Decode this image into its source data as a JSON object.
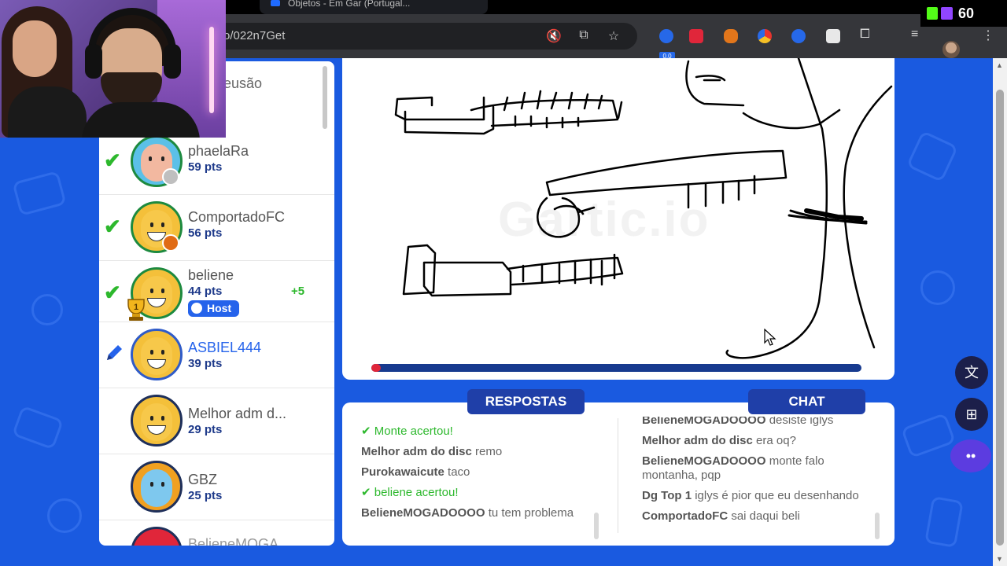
{
  "browser": {
    "tab_title": "Objetos - Em Gar (Portugal...",
    "url": "o/022n7Get",
    "extension_badge": "0.0",
    "viewer_count": "60"
  },
  "players": [
    {
      "name": "eusão",
      "pts": "",
      "state": "partial",
      "gain": "",
      "host": false
    },
    {
      "name": "phaelaRa",
      "pts": "59 pts",
      "state": "guessed",
      "gain": "",
      "host": false,
      "badge_color": "#bfbfbf"
    },
    {
      "name": "ComportadoFC",
      "pts": "56 pts",
      "state": "guessed",
      "gain": "",
      "host": false,
      "badge_color": "#e06b15"
    },
    {
      "name": "beliene",
      "pts": "44 pts",
      "state": "guessed",
      "gain": "+5",
      "host": true,
      "rank": "1"
    },
    {
      "name": "ASBIEL444",
      "pts": "39 pts",
      "state": "drawing",
      "gain": "",
      "host": false
    },
    {
      "name": "Melhor adm d...",
      "pts": "29 pts",
      "state": "none",
      "gain": "",
      "host": false
    },
    {
      "name": "GBZ",
      "pts": "25 pts",
      "state": "none",
      "gain": "",
      "host": false
    },
    {
      "name": "BelieneMOGA...",
      "pts": "",
      "state": "partial",
      "gain": "",
      "host": false
    }
  ],
  "host_label": "Host",
  "canvas": {
    "watermark": "Gartic.io",
    "time_remaining_fraction": 0.02
  },
  "answers": {
    "title": "RESPOSTAS",
    "messages": [
      {
        "user": "Monte",
        "text": "acertou!",
        "correct": true
      },
      {
        "user": "Melhor adm do disc",
        "text": "remo",
        "correct": false
      },
      {
        "user": "Purokawaicute",
        "text": "taco",
        "correct": false
      },
      {
        "user": "beliene",
        "text": "acertou!",
        "correct": true
      },
      {
        "user": "BelieneMOGADOOOO",
        "text": "tu tem problema",
        "correct": false
      }
    ]
  },
  "chat": {
    "title": "CHAT",
    "messages": [
      {
        "user": "BelieneMOGADOOOO",
        "text": "desiste iglys"
      },
      {
        "user": "Melhor adm do disc",
        "text": "era oq?"
      },
      {
        "user": "BelieneMOGADOOOO",
        "text": "monte falo montanha, pqp"
      },
      {
        "user": "Dg Top 1",
        "text": "iglys é pior que eu desenhando"
      },
      {
        "user": "ComportadoFC",
        "text": "sai daqui beli"
      }
    ]
  },
  "colors": {
    "background": "#1a5ae0",
    "correct": "#2db82d",
    "points": "#1e3a8a",
    "tab_header": "#1f3fa8",
    "timer_fill": "#e0263a"
  }
}
